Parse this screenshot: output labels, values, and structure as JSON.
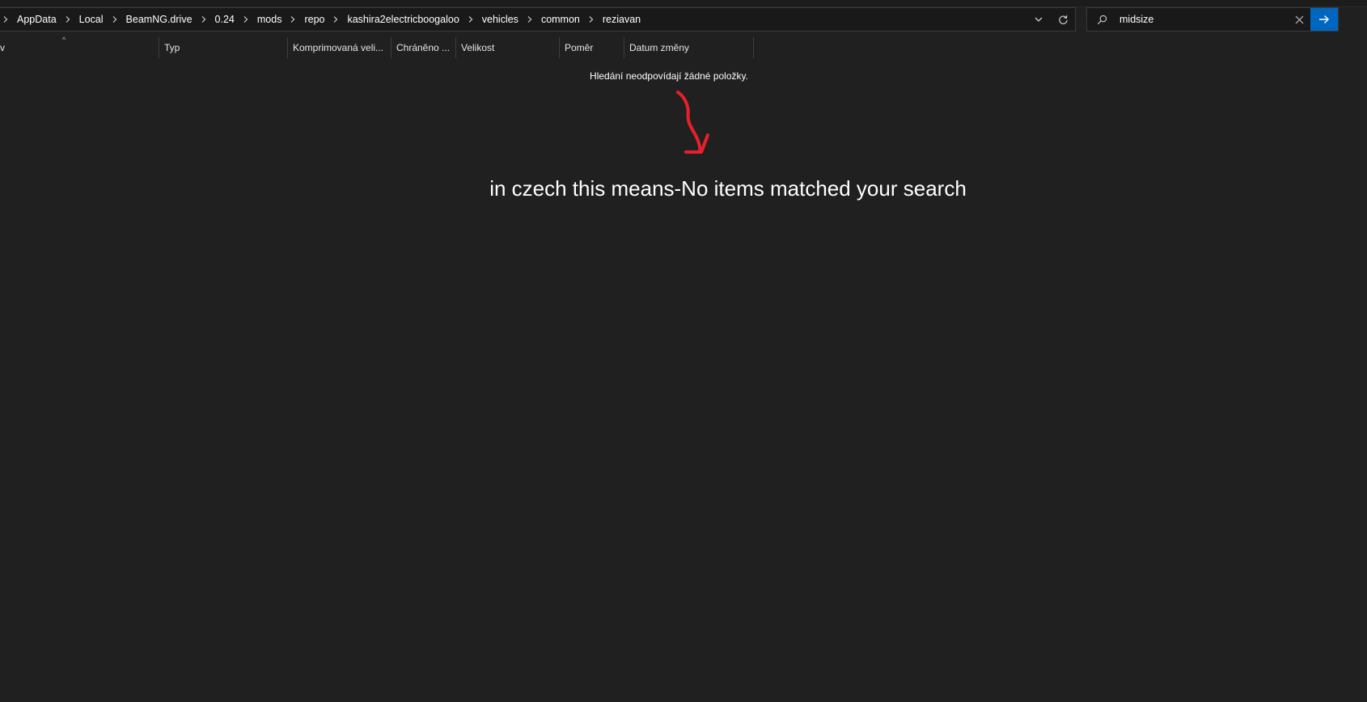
{
  "breadcrumb": {
    "items": [
      {
        "label": "AppData"
      },
      {
        "label": "Local"
      },
      {
        "label": "BeamNG.drive"
      },
      {
        "label": "0.24"
      },
      {
        "label": "mods"
      },
      {
        "label": "repo"
      },
      {
        "label": "kashira2electricboogaloo"
      },
      {
        "label": "vehicles"
      },
      {
        "label": "common"
      },
      {
        "label": "reziavan"
      }
    ]
  },
  "search": {
    "value": "midsize",
    "placeholder": ""
  },
  "columns": {
    "name_partial": "v",
    "type": "Typ",
    "compressed_size": "Komprimovaná veli...",
    "protected": "Chráněno ...",
    "size": "Velikost",
    "ratio": "Poměr",
    "date_modified": "Datum změny"
  },
  "sort_indicator": "^",
  "empty_message": "Hledání neodpovídají žádné položky.",
  "annotation": {
    "text": "in czech this means-No items matched your search",
    "color": "#e8202a"
  },
  "colors": {
    "background": "#202020",
    "accent": "#0067c0"
  },
  "icons": {
    "breadcrumb_separator": "chevron-right-icon",
    "history": "chevron-down-icon",
    "refresh": "refresh-icon",
    "search": "search-icon",
    "clear": "close-icon",
    "go": "arrow-right-icon"
  }
}
